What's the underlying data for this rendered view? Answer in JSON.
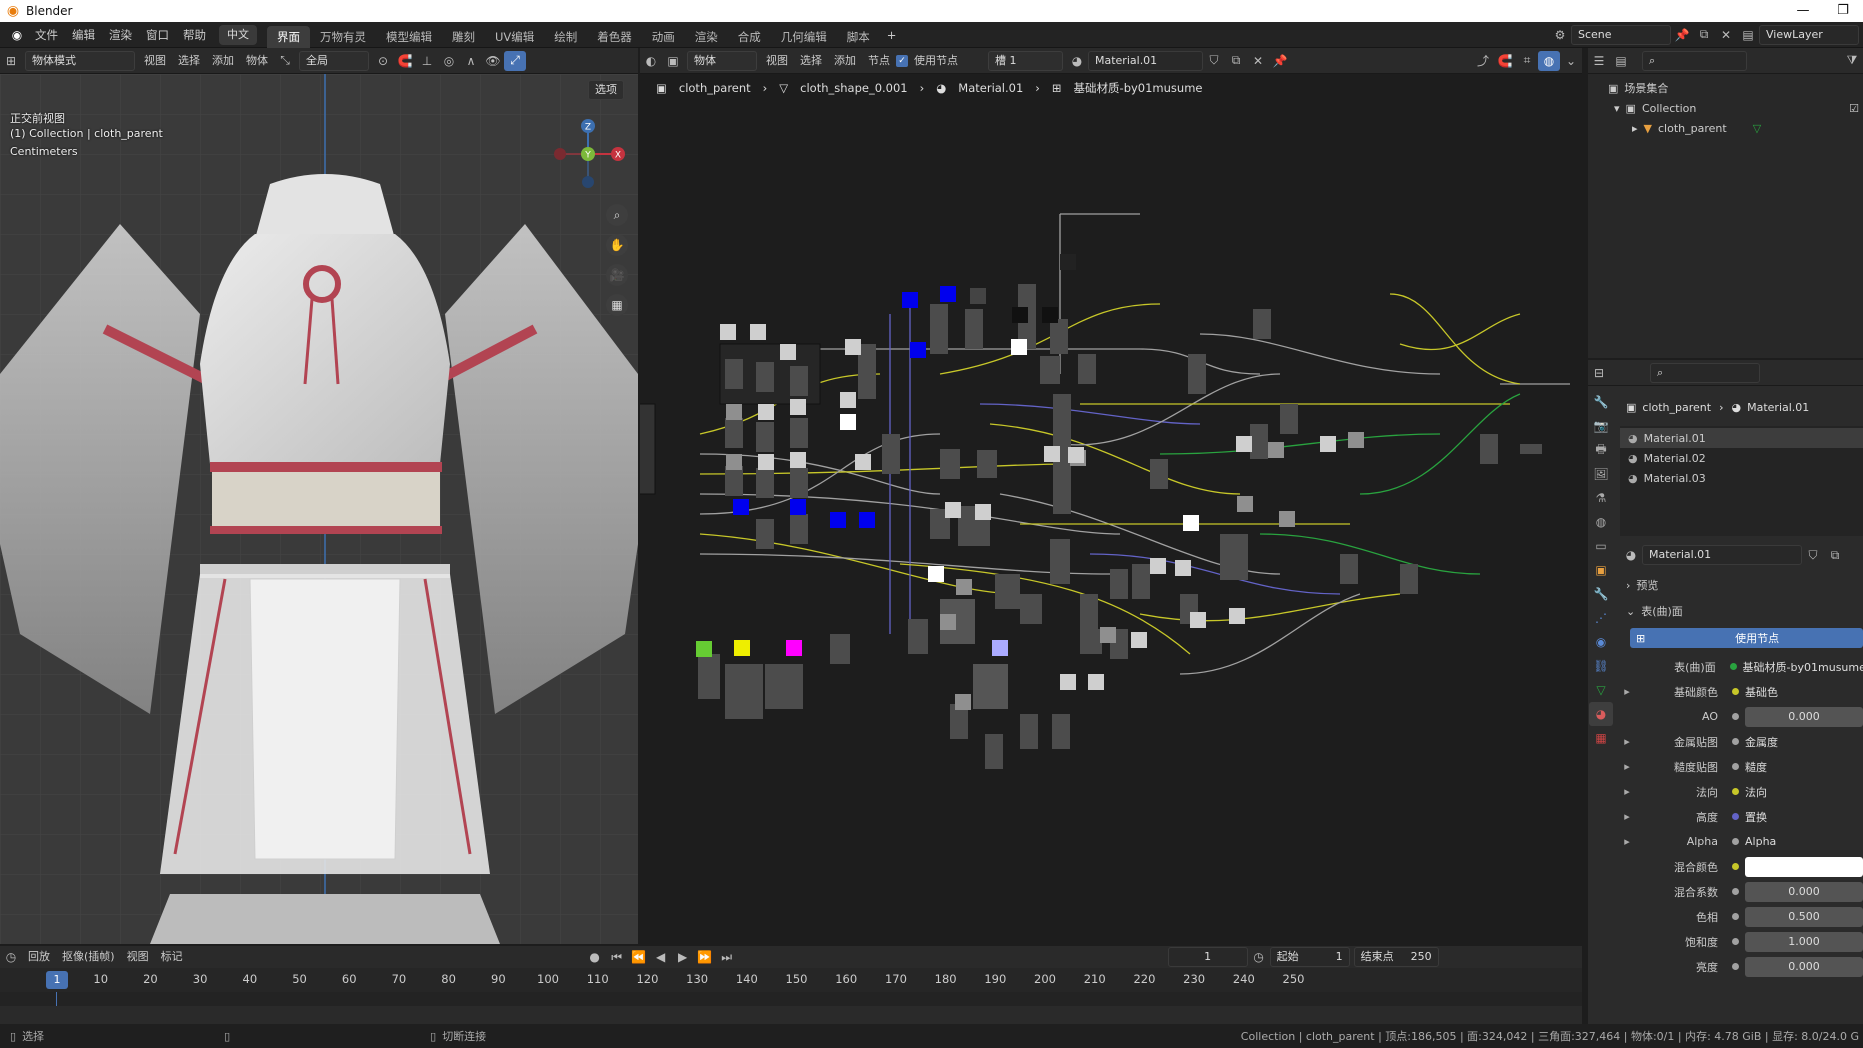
{
  "titlebar": {
    "app_title": "Blender",
    "minimize": "—",
    "maximize": "❐"
  },
  "topbar": {
    "menus": [
      "文件",
      "编辑",
      "渲染",
      "窗口",
      "帮助"
    ],
    "lang_button": "中文",
    "workspace_tabs": [
      "界面",
      "万物有灵",
      "模型编辑",
      "雕刻",
      "UV编辑",
      "绘制",
      "着色器",
      "动画",
      "渲染",
      "合成",
      "几何编辑",
      "脚本"
    ],
    "active_tab_index": 0,
    "add_tab": "+",
    "scene_name": "Scene",
    "view_layer": "ViewLayer"
  },
  "viewport_header": {
    "mode": "物体模式",
    "menus": [
      "视图",
      "选择",
      "添加",
      "物体"
    ],
    "orientation": "全局",
    "options_label": "选项"
  },
  "viewport": {
    "view_name": "正交前视图",
    "collection_info": "(1) Collection | cloth_parent",
    "units": "Centimeters",
    "gizmo_labels": {
      "z": "Z",
      "y": "Y",
      "x": "X"
    }
  },
  "node_header": {
    "object_type": "物体",
    "menus": [
      "视图",
      "选择",
      "添加",
      "节点"
    ],
    "use_nodes_label": "使用节点",
    "use_nodes_checked": true,
    "slot": "槽 1",
    "material": "Material.01"
  },
  "breadcrumb": {
    "items": [
      "cloth_parent",
      "cloth_shape_0.001",
      "Material.01",
      "基础材质-by01musume"
    ]
  },
  "outliner": {
    "scene_collection": "场景集合",
    "collection": "Collection",
    "object": "cloth_parent"
  },
  "properties": {
    "crumb_object": "cloth_parent",
    "crumb_material": "Material.01",
    "material_slots": [
      "Material.01",
      "Material.02",
      "Material.03"
    ],
    "active_material": "Material.01",
    "panel_preview": "预览",
    "panel_surface": "表(曲)面",
    "use_nodes_button": "使用节点",
    "surface_row": {
      "label": "表(曲)面",
      "value": "基础材质-by01musume"
    },
    "rows": [
      {
        "label": "基础颜色",
        "value": "基础色",
        "kind": "link",
        "socket": "#c7c729",
        "expand": true
      },
      {
        "label": "AO",
        "value": "0.000",
        "kind": "num",
        "socket": "#a1a1a1",
        "expand": false
      },
      {
        "label": "金属贴图",
        "value": "金属度",
        "kind": "link",
        "socket": "#a1a1a1",
        "expand": true
      },
      {
        "label": "糙度贴图",
        "value": "糙度",
        "kind": "link",
        "socket": "#a1a1a1",
        "expand": true
      },
      {
        "label": "法向",
        "value": "法向",
        "kind": "link",
        "socket": "#c7c729",
        "expand": true
      },
      {
        "label": "高度",
        "value": "置换",
        "kind": "link",
        "socket": "#6363c7",
        "expand": true
      },
      {
        "label": "Alpha",
        "value": "Alpha",
        "kind": "link",
        "socket": "#a1a1a1",
        "expand": true
      },
      {
        "label": "混合颜色",
        "value": "",
        "kind": "color",
        "socket": "#c7c729",
        "expand": false
      },
      {
        "label": "混合系数",
        "value": "0.000",
        "kind": "num",
        "socket": "#a1a1a1",
        "expand": false
      },
      {
        "label": "色相",
        "value": "0.500",
        "kind": "num",
        "socket": "#a1a1a1",
        "expand": false
      },
      {
        "label": "饱和度",
        "value": "1.000",
        "kind": "num",
        "socket": "#a1a1a1",
        "expand": false
      },
      {
        "label": "亮度",
        "value": "0.000",
        "kind": "num",
        "socket": "#a1a1a1",
        "expand": false
      }
    ]
  },
  "timeline": {
    "menus": [
      "回放",
      "抠像(插帧)",
      "视图",
      "标记"
    ],
    "current_frame": "1",
    "start_label": "起始",
    "start": "1",
    "end_label": "结束点",
    "end": "250",
    "ticks": [
      "10",
      "20",
      "30",
      "40",
      "50",
      "60",
      "70",
      "80",
      "90",
      "100",
      "110",
      "120",
      "130",
      "140",
      "150",
      "160",
      "170",
      "180",
      "190",
      "200",
      "210",
      "220",
      "230",
      "240",
      "250"
    ]
  },
  "statusbar": {
    "select": "选择",
    "cut_links": "切断连接",
    "stats": "Collection | cloth_parent | 顶点:186,505 | 面:324,042 | 三角面:327,464 | 物体:0/1 | 内存: 4.78 GiB | 显存: 8.0/24.0 G"
  },
  "colors": {
    "accent": "#4772b3",
    "node_link_yellow": "#c7c729",
    "node_link_gray": "#a1a1a1",
    "node_link_blue": "#6363c7",
    "node_link_green": "#29a33f"
  }
}
